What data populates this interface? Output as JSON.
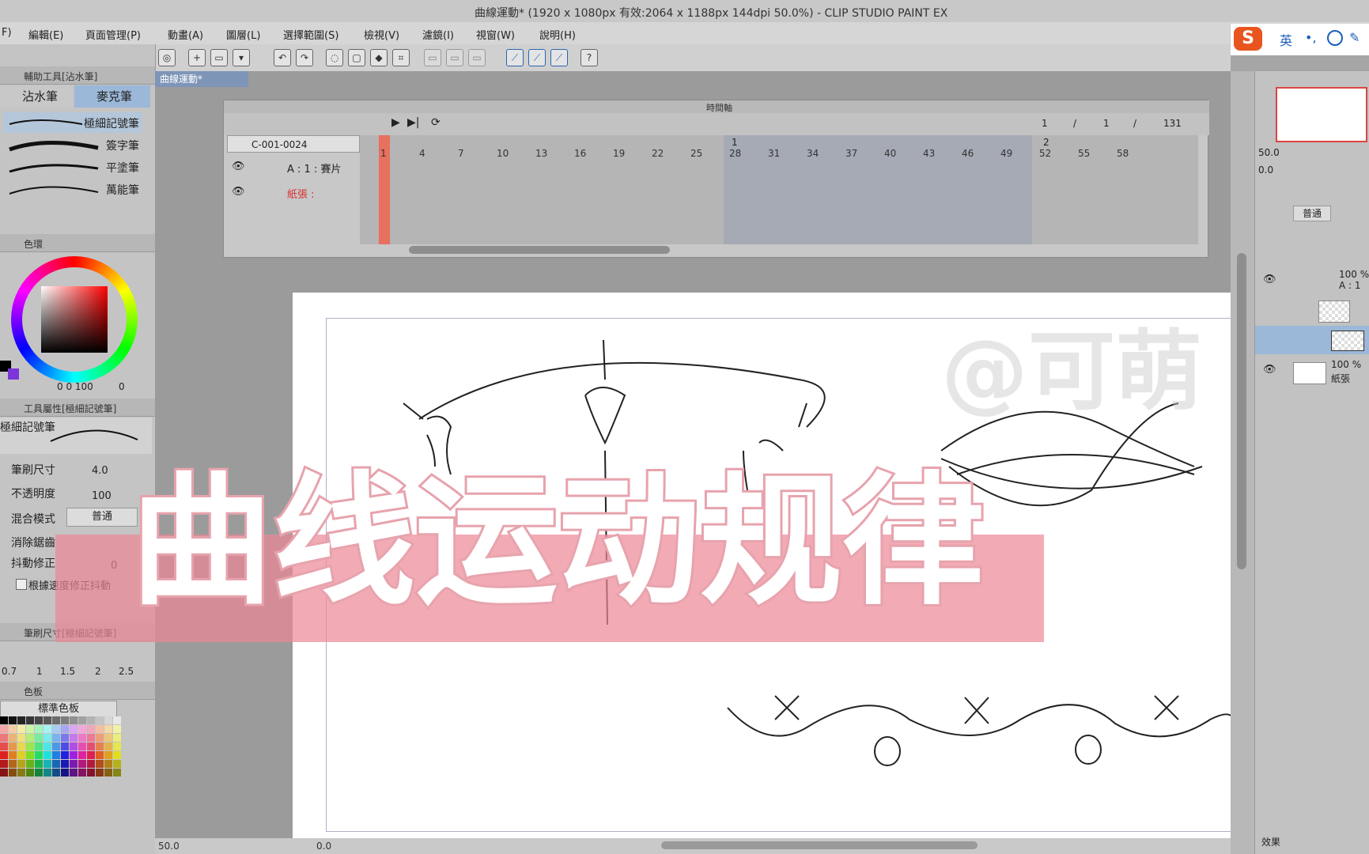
{
  "window": {
    "title": "曲線運動* (1920 x 1080px 有效:2064 x 1188px 144dpi 50.0%) - CLIP STUDIO PAINT EX"
  },
  "menu": [
    "F)",
    "編輯(E)",
    "頁面管理(P)",
    "動畫(A)",
    "圖層(L)",
    "選擇範圍(S)",
    "檢視(V)",
    "濾鏡(I)",
    "視窗(W)",
    "說明(H)"
  ],
  "ime": {
    "logo": "S",
    "lang": "英"
  },
  "left_panel": {
    "subtool_header": "輔助工具[沾水筆]",
    "tabs": [
      "沾水筆",
      "麥克筆"
    ],
    "brushes": [
      "極細記號筆",
      "簽字筆",
      "平塗筆",
      "萬能筆"
    ],
    "color_header": "色環",
    "color_values": "0 0 100",
    "color_extra": "0",
    "tool_prop_header": "工具屬性[極細記號筆]",
    "tool_name": "極細記號筆",
    "props": [
      {
        "label": "筆刷尺寸",
        "value": "4.0"
      },
      {
        "label": "不透明度",
        "value": "100"
      },
      {
        "label": "混合模式",
        "value": "普通"
      },
      {
        "label": "消除鋸齒",
        "value": ""
      },
      {
        "label": "抖動修正",
        "value": "0"
      }
    ],
    "stabilize_label": "根據速度修正抖動",
    "brush_size_header": "筆刷尺寸[極細記號筆]",
    "sizes": [
      "0.7",
      "1",
      "1.5",
      "2",
      "2.5"
    ],
    "palette_tab": "色板",
    "palette_name": "標準色板"
  },
  "document_tab": "曲線運動*",
  "timeline": {
    "header": "時間軸",
    "track_name": "C-001-0024",
    "layers": [
      {
        "label": "A : 1 : 賽片",
        "color": "#222222"
      },
      {
        "label": "紙張 :",
        "color": "#d93030"
      }
    ],
    "frames": [
      "1",
      "4",
      "7",
      "10",
      "13",
      "16",
      "19",
      "22",
      "25",
      "28",
      "31",
      "34",
      "37",
      "40",
      "43",
      "46",
      "49",
      "52",
      "55",
      "58"
    ],
    "markers": [
      "1",
      "2"
    ],
    "counter": {
      "current": "1",
      "sep1": "/",
      "total": "1",
      "sep2": "/",
      "end": "131"
    }
  },
  "overlay": {
    "title": "曲线运动规律",
    "watermark": "@可萌"
  },
  "right_panel": {
    "zoom": "50.0",
    "angle": "0.0",
    "blend": "普通",
    "layer_opacity_1": "100 %",
    "layer_sub_1": "A : 1",
    "layer_opacity_2": "100 %",
    "layer_name_2": "紙張",
    "effect_label": "效果"
  },
  "status": {
    "zoom": "50.0",
    "angle": "0.0"
  },
  "colors": {
    "accent": "#7e95b8",
    "playhead": "#e8705f",
    "overlay_band": "#ec8896"
  }
}
